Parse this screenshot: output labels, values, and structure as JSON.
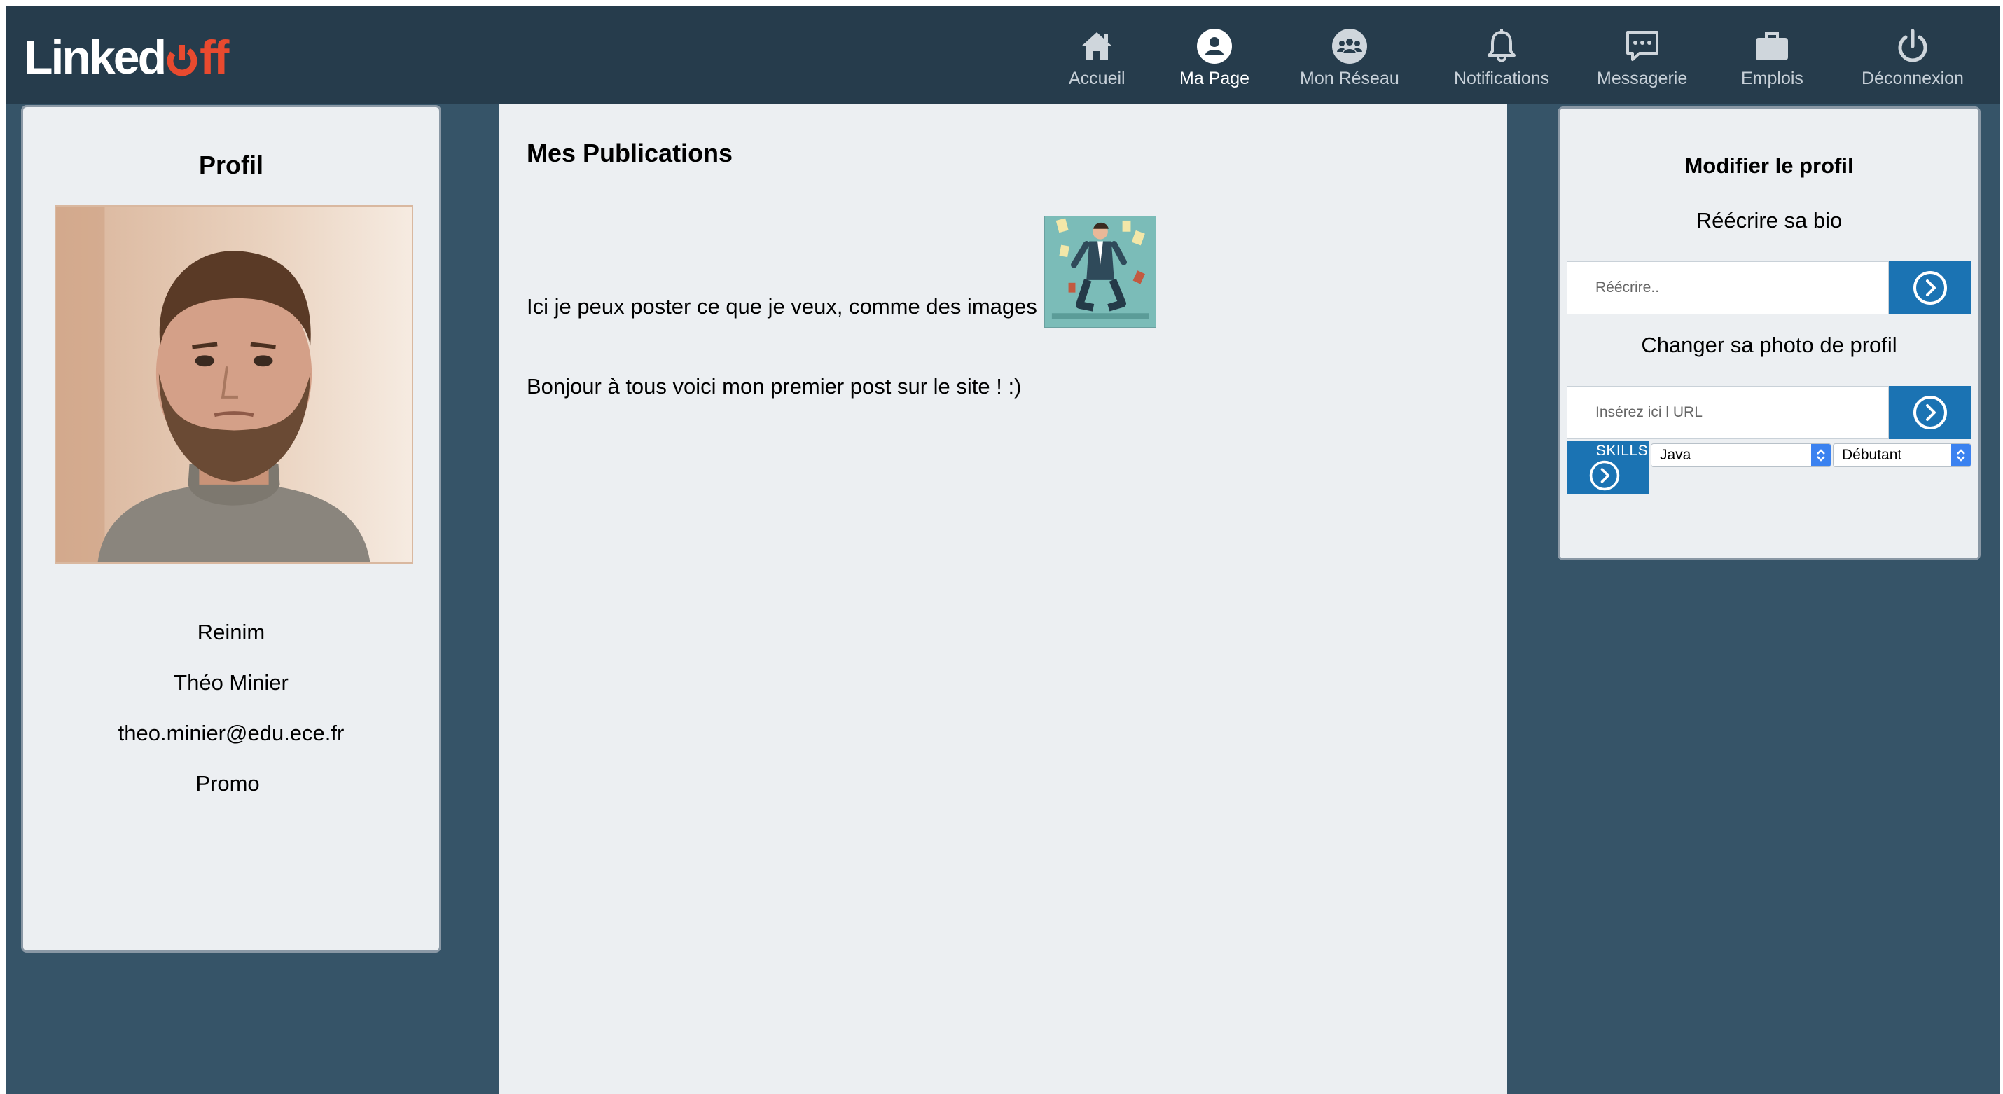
{
  "app": {
    "logo_main": "Linked",
    "logo_accent_letters": "ff"
  },
  "nav": {
    "items": [
      {
        "label": "Accueil",
        "icon": "home-icon"
      },
      {
        "label": "Ma Page",
        "icon": "user-icon",
        "active": true
      },
      {
        "label": "Mon Réseau",
        "icon": "network-icon"
      },
      {
        "label": "Notifications",
        "icon": "bell-icon"
      },
      {
        "label": "Messagerie",
        "icon": "chat-icon"
      },
      {
        "label": "Emplois",
        "icon": "briefcase-icon"
      },
      {
        "label": "Déconnexion",
        "icon": "power-icon"
      }
    ]
  },
  "profile": {
    "title": "Profil",
    "username": "Reinim",
    "full_name": "Théo Minier",
    "email": "theo.minier@edu.ece.fr",
    "promo": "Promo"
  },
  "publications": {
    "title": "Mes Publications",
    "posts": [
      {
        "text": "Ici je peux poster ce que je veux, comme des images"
      },
      {
        "text": "Bonjour à tous voici mon premier post sur le site ! :)"
      }
    ]
  },
  "edit_profile": {
    "title": "Modifier le profil",
    "bio_label": "Réécrire sa bio",
    "bio_placeholder": "Réécrire..",
    "photo_label": "Changer sa photo de profil",
    "photo_placeholder": "Insérez ici l URL",
    "skills_label": "SKILLS",
    "skill_selected": "Java",
    "level_selected": "Débutant"
  },
  "colors": {
    "navbar": "#263c4c",
    "background": "#365468",
    "card": "#eceff2",
    "button": "#1b73b3",
    "logo_accent": "#e84a2f"
  }
}
